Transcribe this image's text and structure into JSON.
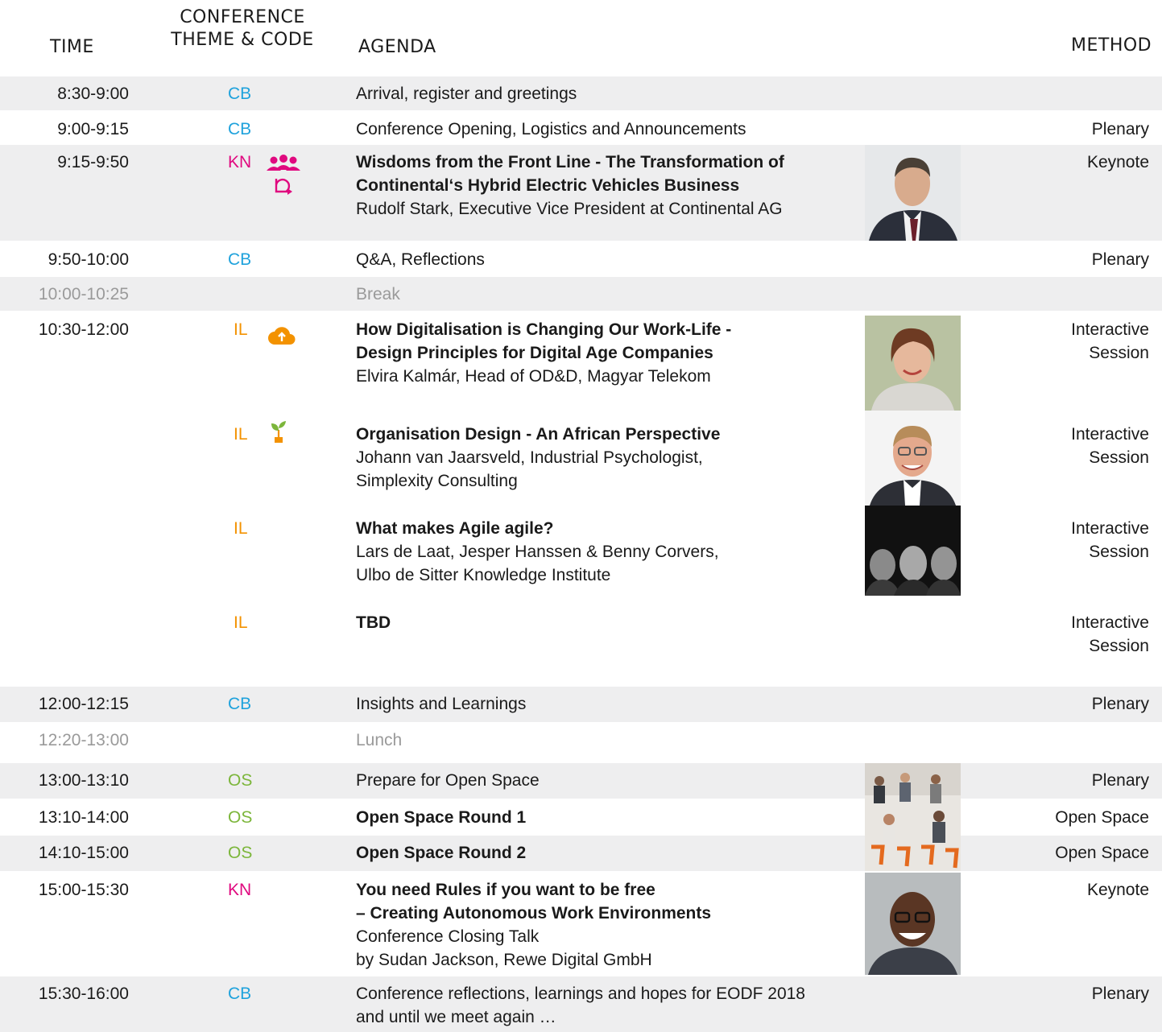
{
  "headers": {
    "time": "TIME",
    "theme": "CONFERENCE\nTHEME & CODE",
    "agenda": "AGENDA",
    "method": "METHOD"
  },
  "colors": {
    "CB": "#1fa2dc",
    "KN": "#e0097f",
    "IL": "#f39200",
    "OS": "#7cb63b",
    "muted": "#9a9a9a",
    "shade": "#eeeeef"
  },
  "rows": [
    {
      "time": "8:30-9:00",
      "code": "CB",
      "title": "Arrival, register and greetings",
      "method": ""
    },
    {
      "time": "9:00-9:15",
      "code": "CB",
      "title": "Conference Opening, Logistics and Announcements",
      "method": "Plenary"
    },
    {
      "time": "9:15-9:50",
      "code": "KN",
      "icon": "people-group-icon, loop-arrow-icon",
      "title": "Wisdoms from the Front Line - The Transformation of",
      "title2": "Continental‘s Hybrid Electric Vehicles Business",
      "speaker": "Rudolf Stark, Executive Vice President at Continental AG",
      "method": "Keynote"
    },
    {
      "time": "9:50-10:00",
      "code": "CB",
      "title": "Q&A, Reflections",
      "method": "Plenary"
    },
    {
      "time": "10:00-10:25",
      "code": "",
      "title": "Break",
      "method": ""
    },
    {
      "time": "10:30-12:00",
      "code": "IL",
      "icon": "cloud-upload-icon",
      "title": "How Digitalisation is Changing Our Work-Life -",
      "title2": "Design Principles for Digital Age Companies",
      "speaker": "Elvira Kalmár, Head of OD&D, Magyar Telekom",
      "method": "Interactive",
      "method2": "Session"
    },
    {
      "time": "",
      "code": "IL",
      "icon": "sprout-icon",
      "title": "Organisation Design - An African Perspective",
      "speaker": "Johann van Jaarsveld, Industrial Psychologist,",
      "speaker2": "Simplexity Consulting",
      "method": "Interactive",
      "method2": "Session"
    },
    {
      "time": "",
      "code": "IL",
      "title": "What makes Agile agile?",
      "speaker": "Lars de Laat, Jesper Hanssen & Benny Corvers,",
      "speaker2": "Ulbo de Sitter Knowledge Institute",
      "method": "Interactive",
      "method2": "Session"
    },
    {
      "time": "",
      "code": "IL",
      "title": "TBD",
      "method": "Interactive",
      "method2": "Session"
    },
    {
      "time": "12:00-12:15",
      "code": "CB",
      "title": "Insights and Learnings",
      "method": "Plenary"
    },
    {
      "time": "12:20-13:00",
      "code": "",
      "title": "Lunch",
      "method": ""
    },
    {
      "time": "13:00-13:10",
      "code": "OS",
      "title": "Prepare for Open Space",
      "method": "Plenary"
    },
    {
      "time": "13:10-14:00",
      "code": "OS",
      "title": "Open Space Round 1",
      "method": "Open Space"
    },
    {
      "time": "14:10-15:00",
      "code": "OS",
      "title": "Open Space Round 2",
      "method": "Open Space"
    },
    {
      "time": "15:00-15:30",
      "code": "KN",
      "title": "You need Rules if you want to be free",
      "title2": "– Creating Autonomous Work Environments",
      "speaker": "Conference Closing Talk",
      "speaker2": "by Sudan Jackson, Rewe Digital GmbH",
      "method": "Keynote"
    },
    {
      "time": "15:30-16:00",
      "code": "CB",
      "title": "Conference reflections, learnings and hopes for EODF 2018",
      "title2": "and until we meet again …",
      "method": "Plenary"
    }
  ]
}
